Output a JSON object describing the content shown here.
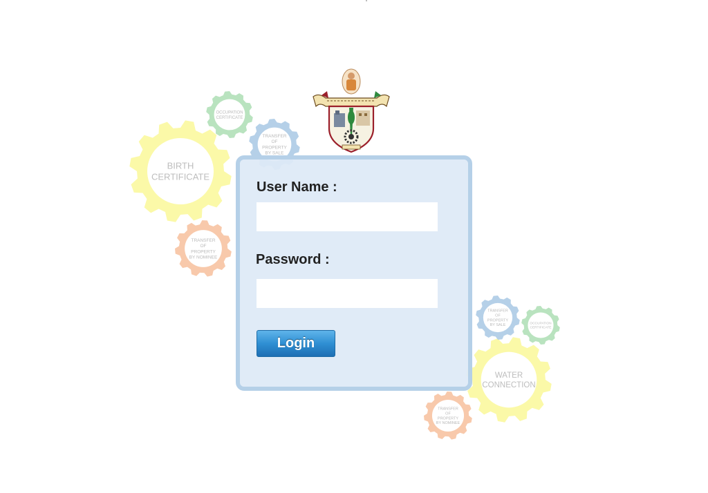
{
  "login": {
    "username_label": "User Name :",
    "username_value": "",
    "password_label": "Password :",
    "password_value": "",
    "button_label": "Login"
  },
  "background_gears": {
    "birth_certificate": {
      "line1": "BIRTH",
      "line2": "CERTIFICATE",
      "color": "#fbf9a8"
    },
    "water_connection": {
      "line1": "WATER",
      "line2": "CONNECTION",
      "color": "#fbf9a8"
    },
    "occupation_certificate_left": {
      "line1": "OCCUPATION",
      "line2": "CERTIFICATE",
      "color": "#b9e3bf"
    },
    "occupation_certificate_right": {
      "line1": "OCCUPATION",
      "line2": "CERTIFICATE",
      "color": "#b9e3bf"
    },
    "transfer_by_sale_left": {
      "line1": "TRANSFER",
      "line2": "OF",
      "line3": "PROPERTY",
      "line4": "BY SALE",
      "color": "#b5d0e8"
    },
    "transfer_by_sale_right": {
      "line1": "TRANSFER",
      "line2": "OF",
      "line3": "PROPERTY",
      "line4": "BY SALE",
      "color": "#b5d0e8"
    },
    "transfer_by_nominee_left": {
      "line1": "TRANSFER",
      "line2": "OF",
      "line3": "PROPERTY",
      "line4": "BY NOMINEE",
      "color": "#f8c9ab"
    },
    "transfer_by_nominee_right": {
      "line1": "TRANSFER",
      "line2": "OF",
      "line3": "PROPERTY",
      "line4": "BY NOMINEE",
      "color": "#f8c9ab"
    }
  },
  "emblem": {
    "icon": "municipal-corporation-emblem-icon",
    "colors": {
      "scroll": "#f3e3b0",
      "shield": "#9b1f2a",
      "green": "#2f8a3e"
    }
  },
  "theme": {
    "panel_bg": "#deeaf6",
    "panel_border": "#b5d0e8",
    "button": "#2f8fd3"
  }
}
